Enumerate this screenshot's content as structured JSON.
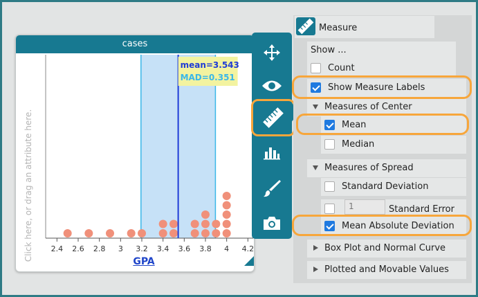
{
  "graph": {
    "title": "cases",
    "y_hint": "Click here, or drag an attribute here.",
    "x_title": "GPA",
    "mean_label": "mean=3.543",
    "mad_label": "MAD=0.351"
  },
  "chart_data": {
    "type": "scatter",
    "title": "cases",
    "xlabel": "GPA",
    "ylabel": "",
    "xlim": [
      2.3,
      4.25
    ],
    "x_ticks": [
      "2.4",
      "2.6",
      "2.8",
      "3",
      "3.2",
      "3.4",
      "3.6",
      "3.8",
      "4",
      "4.2"
    ],
    "x_tick_values": [
      2.4,
      2.6,
      2.8,
      3.0,
      3.2,
      3.4,
      3.6,
      3.8,
      4.0,
      4.2
    ],
    "points": [
      {
        "x": 2.5,
        "stack": 0
      },
      {
        "x": 2.7,
        "stack": 0
      },
      {
        "x": 2.9,
        "stack": 0
      },
      {
        "x": 3.1,
        "stack": 0
      },
      {
        "x": 3.2,
        "stack": 0
      },
      {
        "x": 3.4,
        "stack": 0
      },
      {
        "x": 3.4,
        "stack": 1
      },
      {
        "x": 3.5,
        "stack": 0
      },
      {
        "x": 3.5,
        "stack": 1
      },
      {
        "x": 3.7,
        "stack": 0
      },
      {
        "x": 3.7,
        "stack": 1
      },
      {
        "x": 3.8,
        "stack": 0
      },
      {
        "x": 3.8,
        "stack": 1
      },
      {
        "x": 3.8,
        "stack": 2
      },
      {
        "x": 3.9,
        "stack": 0
      },
      {
        "x": 3.9,
        "stack": 1
      },
      {
        "x": 4.0,
        "stack": 0
      },
      {
        "x": 4.0,
        "stack": 1
      },
      {
        "x": 4.0,
        "stack": 2
      },
      {
        "x": 4.0,
        "stack": 3
      },
      {
        "x": 4.0,
        "stack": 4
      }
    ],
    "mean": 3.543,
    "mad": 0.351,
    "point_color": "#f0907a",
    "mean_color": "#1e3bd6",
    "mad_band_color": "#c6e1f7",
    "mad_line_color": "#39b7e8",
    "label_bg_color": "#f3f3a0"
  },
  "toolbar": {
    "tools": [
      "move-icon",
      "eye-icon",
      "ruler-icon",
      "chart-icon",
      "brush-icon",
      "camera-icon"
    ],
    "selected": "ruler-icon"
  },
  "panel": {
    "title": "Measure",
    "show_heading": "Show ...",
    "count_label": "Count",
    "count_checked": false,
    "show_measure_labels_label": "Show Measure Labels",
    "show_measure_labels_checked": true,
    "center_heading": "Measures of Center",
    "mean_label": "Mean",
    "mean_checked": true,
    "median_label": "Median",
    "median_checked": false,
    "spread_heading": "Measures of Spread",
    "sd_label": "Standard Deviation",
    "sd_checked": false,
    "se_value": "1",
    "se_label": "Standard Error",
    "se_checked": false,
    "mad_label": "Mean Absolute Deviation",
    "mad_checked": true,
    "boxplot_label": "Box Plot and Normal Curve",
    "plotted_label": "Plotted and Movable Values"
  },
  "colors": {
    "teal": "#177991",
    "frame": "#2e7b85",
    "highlight": "#f7a63b",
    "check": "#1f7ae0"
  }
}
